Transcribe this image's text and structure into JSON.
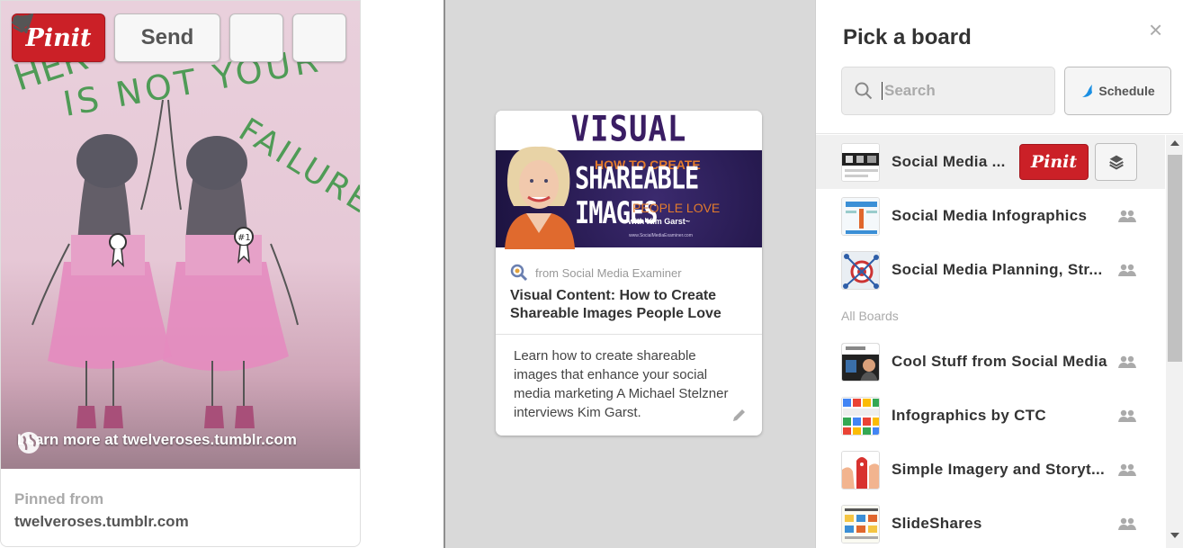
{
  "pin": {
    "pinit_label": "Pinit",
    "send_label": "Send",
    "learn_more": "Learn more at twelveroses.tumblr.com",
    "pinned_from_label": "Pinned from",
    "pinned_from_domain": "twelveroses.tumblr.com",
    "image_text": {
      "line1": "HER",
      "line2": "IS NOT YOUR",
      "line3": "FAILURE"
    }
  },
  "preview": {
    "image_text": {
      "header": "VISUAL CONTENT:",
      "how_to": "HOW TO CREATE",
      "shareable": "SHAREABLE IMAGES",
      "people_love": "PEOPLE LOVE",
      "with": "~with Kim Garst~",
      "url": "www.SocialMediaExaminer.com"
    },
    "source": "from Social Media Examiner",
    "title": "Visual Content: How to Create Shareable Images People Love",
    "description": "Learn how to create shareable images that enhance your social media marketing A Michael Stelzner interviews Kim Garst."
  },
  "board_picker": {
    "title": "Pick a board",
    "close": "×",
    "search_placeholder": "Search",
    "search_value": "",
    "schedule_label": "Schedule",
    "row_pinit_label": "Pinit",
    "all_boards_label": "All Boards",
    "top_boards": [
      {
        "name": "Social Media ...",
        "collaborative": false
      },
      {
        "name": "Social Media Infographics",
        "collaborative": true
      },
      {
        "name": "Social Media Planning, Str...",
        "collaborative": true
      }
    ],
    "all_boards": [
      {
        "name": "Cool Stuff from Social Media",
        "collaborative": true
      },
      {
        "name": "Infographics by CTC",
        "collaborative": true
      },
      {
        "name": "Simple Imagery and Storyt...",
        "collaborative": true
      },
      {
        "name": "SlideShares",
        "collaborative": true
      }
    ]
  },
  "colors": {
    "pinterest_red": "#cb2027",
    "schedule_blue": "#1a8fe3"
  }
}
